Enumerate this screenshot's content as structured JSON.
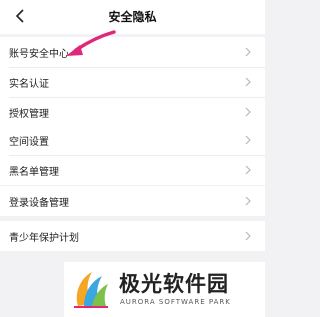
{
  "header": {
    "title": "安全隐私"
  },
  "groups": [
    {
      "items": [
        {
          "label": "账号安全中心"
        },
        {
          "label": "实名认证"
        },
        {
          "label": "授权管理"
        }
      ]
    },
    {
      "items": [
        {
          "label": "空间设置"
        },
        {
          "label": "黑名单管理"
        }
      ]
    },
    {
      "items": [
        {
          "label": "登录设备管理"
        }
      ]
    },
    {
      "items": [
        {
          "label": "青少年保护计划"
        }
      ]
    }
  ],
  "watermark": {
    "name_cn": "极光软件园",
    "name_en": "AURORA SOFTWARE PARK"
  },
  "colors": {
    "arrow": "#e0287a",
    "chevron": "#b8b8b8",
    "divider": "#ececec",
    "background": "#f2f2f4"
  },
  "icons": [
    "back-icon",
    "chevron-right-icon",
    "annotation-arrow-icon",
    "aurora-logo-icon"
  ]
}
